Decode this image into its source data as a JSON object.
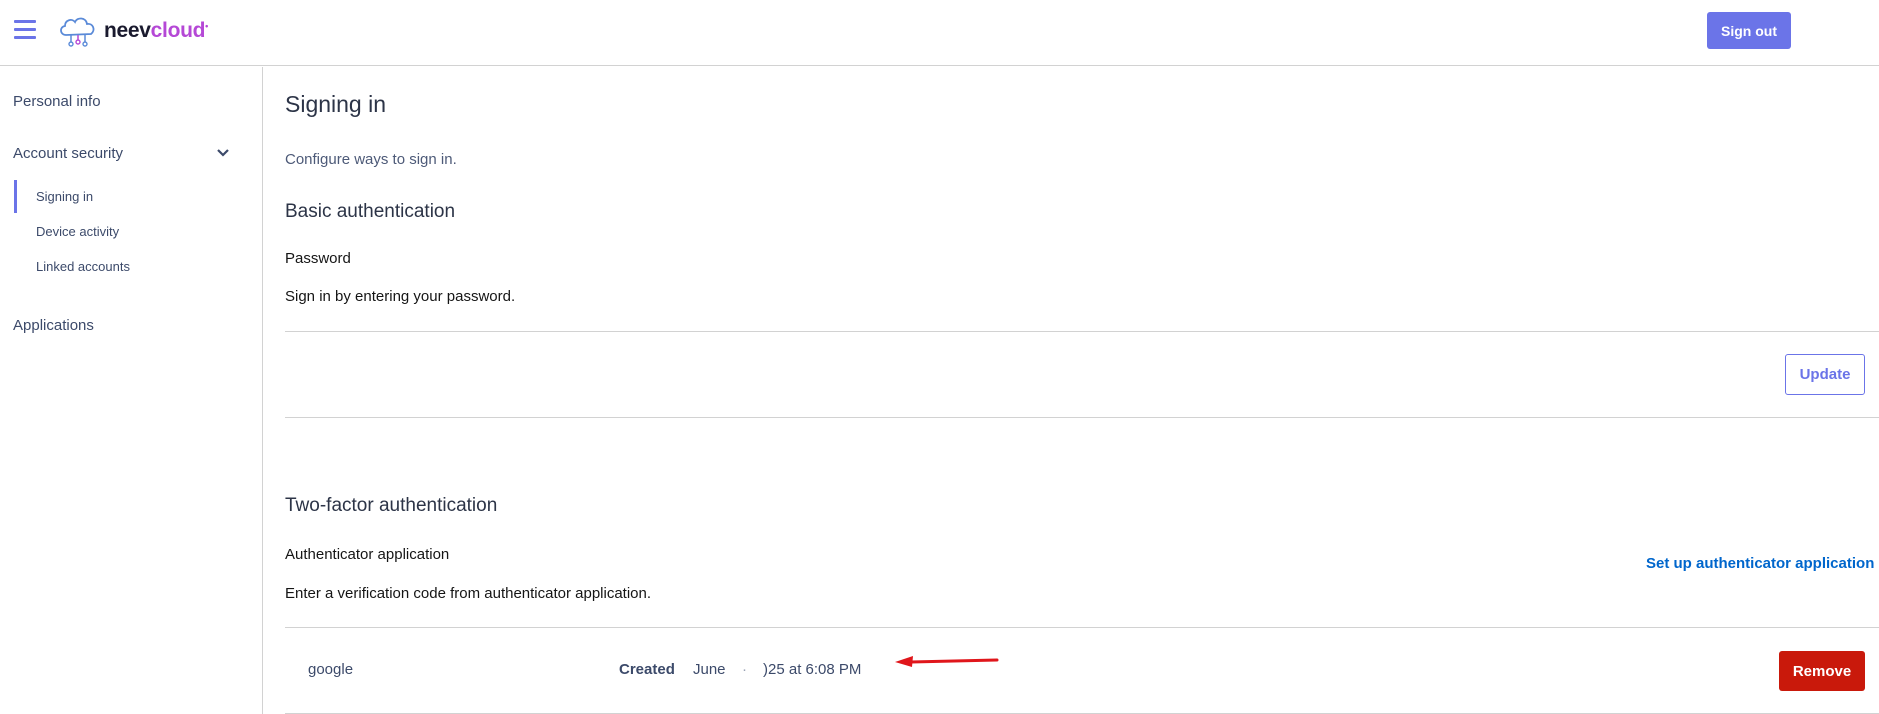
{
  "header": {
    "brand_part1": "neev",
    "brand_part2": "cloud",
    "brand_mark": "•",
    "signout_label": "Sign out"
  },
  "sidebar": {
    "personal_info": "Personal info",
    "account_security": "Account security",
    "sub_items": [
      "Signing in",
      "Device activity",
      "Linked accounts"
    ],
    "applications": "Applications"
  },
  "main": {
    "title": "Signing in",
    "subtitle": "Configure ways to sign in.",
    "basic": {
      "title": "Basic authentication",
      "label": "Password",
      "description": "Sign in by entering your password.",
      "update_label": "Update"
    },
    "twofactor": {
      "title": "Two-factor authentication",
      "label": "Authenticator application",
      "description": "Enter a verification code from authenticator application.",
      "setup_label": "Set up authenticator application",
      "row": {
        "name": "google",
        "created_label": "Created",
        "created_month": "June",
        "created_dot": "·",
        "created_time": ")25 at 6:08 PM",
        "remove_label": "Remove"
      }
    }
  },
  "colors": {
    "accent": "#6b74e8",
    "danger": "#c9190b",
    "link": "#0066cc",
    "annotation_arrow": "#e0161b"
  }
}
